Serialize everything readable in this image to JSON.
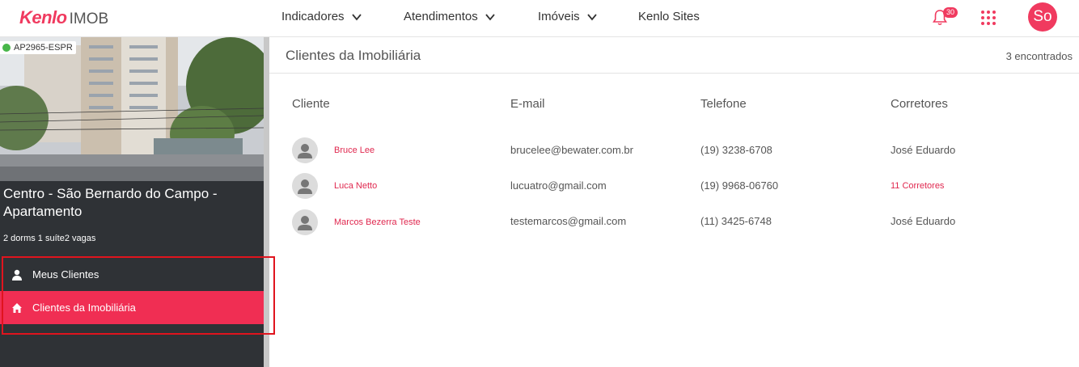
{
  "header": {
    "logo_brand": "Kenlo",
    "logo_product": "IMOB",
    "nav": [
      {
        "label": "Indicadores",
        "has_dropdown": true
      },
      {
        "label": "Atendimentos",
        "has_dropdown": true
      },
      {
        "label": "Imóveis",
        "has_dropdown": true
      },
      {
        "label": "Kenlo Sites",
        "has_dropdown": false
      }
    ],
    "notifications_count": "30",
    "user_initials": "So",
    "icons": [
      "bell-icon",
      "apps-grid-icon"
    ]
  },
  "sidebar": {
    "property_code": "AP2965-ESPR",
    "status_color": "#47b649",
    "property_title": "Centro - São Bernardo do Campo - Apartamento",
    "property_specs": "2 dorms 1 suíte2 vagas",
    "menu": [
      {
        "label": "Meus Clientes",
        "icon": "user-icon",
        "active": false
      },
      {
        "label": "Clientes da Imobiliária",
        "icon": "home-icon",
        "active": true
      }
    ]
  },
  "main": {
    "title": "Clientes da Imobiliária",
    "count_label": "3 encontrados",
    "columns": [
      "Cliente",
      "E-mail",
      "Telefone",
      "Corretores"
    ],
    "rows": [
      {
        "name": "Bruce Lee",
        "email": "brucelee@bewater.com.br",
        "phone": "(19) 3238-6708",
        "broker": "José Eduardo",
        "broker_is_link": false
      },
      {
        "name": "Luca Netto",
        "email": "lucuatro@gmail.com",
        "phone": "(19) 9968-06760",
        "broker": "11 Corretores",
        "broker_is_link": true
      },
      {
        "name": "Marcos Bezerra Teste",
        "email": "testemarcos@gmail.com",
        "phone": "(11) 3425-6748",
        "broker": "José Eduardo",
        "broker_is_link": false
      }
    ]
  },
  "colors": {
    "accent": "#f03a5f",
    "active_menu": "#f02e53",
    "sidebar_bg": "#2f3236",
    "highlight_box": "#e0141e"
  }
}
